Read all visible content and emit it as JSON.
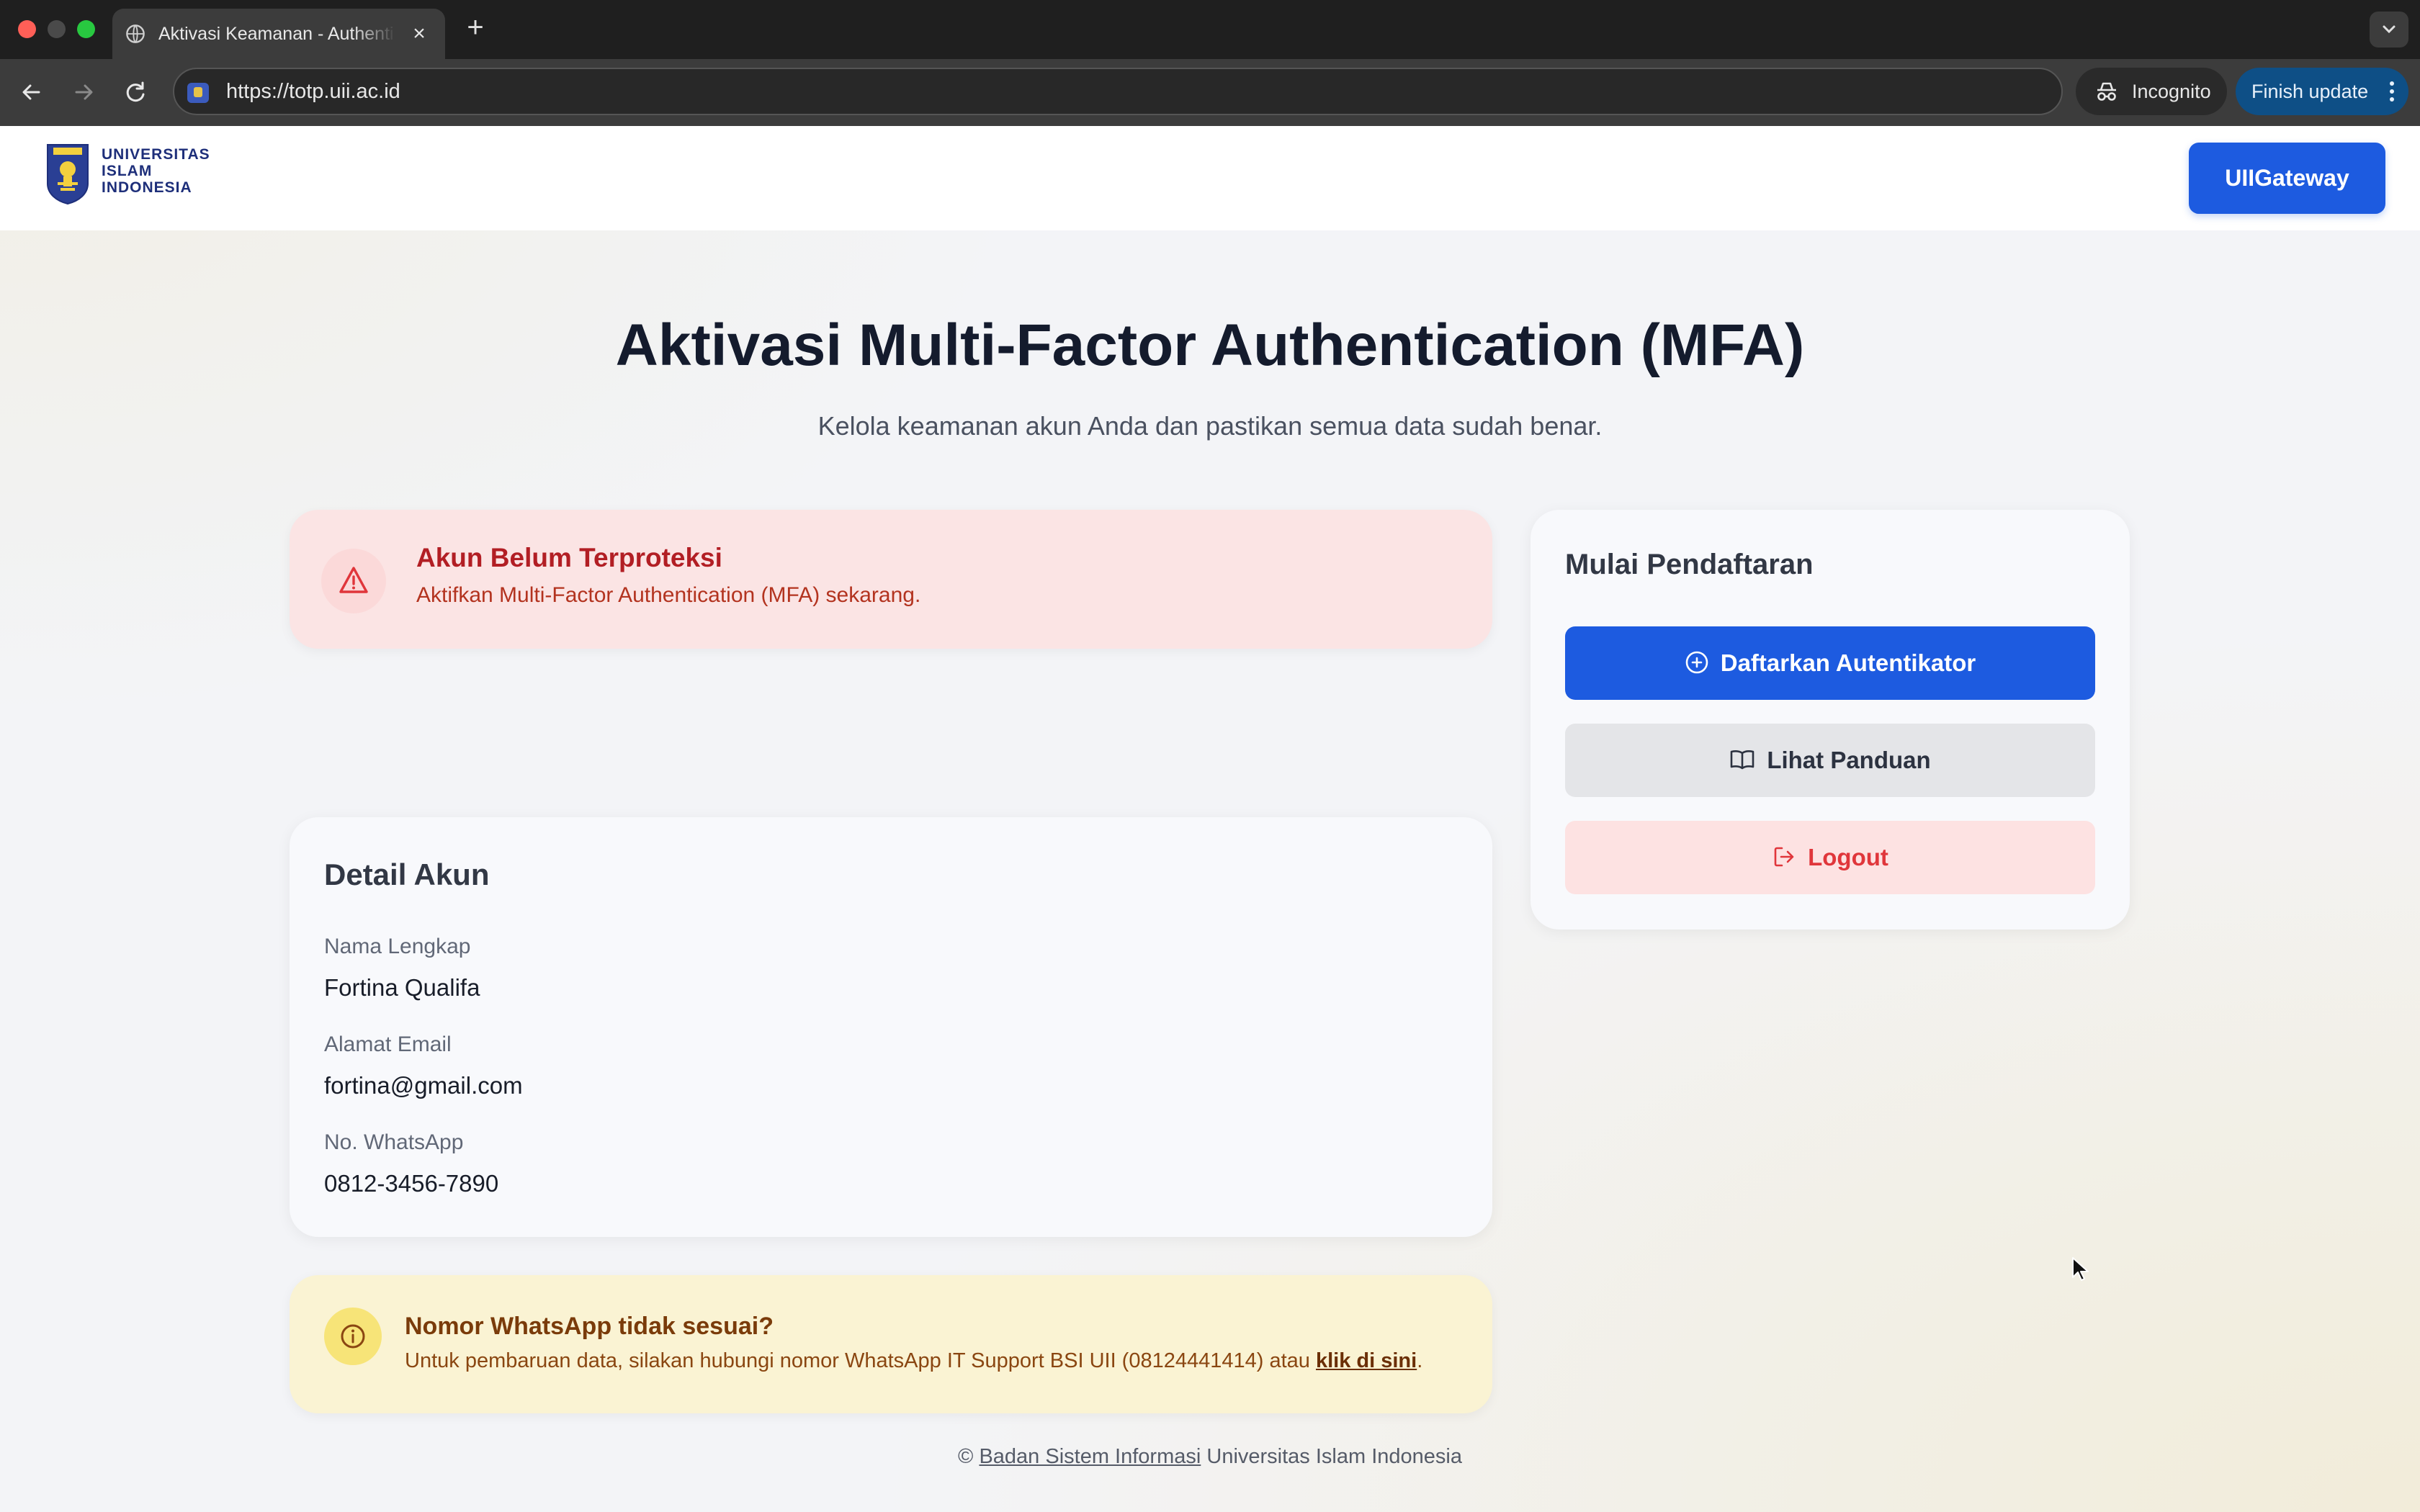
{
  "browser": {
    "tab_title": "Aktivasi Keamanan - Authenti",
    "url": "https://totp.uii.ac.id",
    "incognito_label": "Incognito",
    "finish_update_label": "Finish update"
  },
  "header": {
    "logo_lines": [
      "UNIVERSITAS",
      "ISLAM",
      "INDONESIA"
    ],
    "gateway_button": "UIIGateway"
  },
  "main": {
    "title": "Aktivasi Multi-Factor Authentication (MFA)",
    "subtitle": "Kelola keamanan akun Anda dan pastikan semua data sudah benar."
  },
  "alert": {
    "title": "Akun Belum Terproteksi",
    "message": "Aktifkan Multi-Factor Authentication (MFA) sekarang."
  },
  "account": {
    "heading": "Detail Akun",
    "name_label": "Nama Lengkap",
    "name_value": "Fortina Qualifa",
    "email_label": "Alamat Email",
    "email_value": "fortina@gmail.com",
    "whatsapp_label": "No. WhatsApp",
    "whatsapp_value": "0812-3456-7890"
  },
  "notice": {
    "title": "Nomor WhatsApp tidak sesuai?",
    "text_before": "Untuk pembaruan data, silakan hubungi nomor WhatsApp IT Support BSI UII (08124441414) atau ",
    "link": "klik di sini",
    "text_after": "."
  },
  "registration": {
    "heading": "Mulai Pendaftaran",
    "register_button": "Daftarkan Autentikator",
    "guide_button": "Lihat Panduan",
    "logout_button": "Logout"
  },
  "footer": {
    "copyright": "©",
    "link": "Badan Sistem Informasi",
    "org": "Universitas Islam Indonesia"
  },
  "colors": {
    "primary": "#1d5be0",
    "danger": "#e0363b",
    "warning_bg": "#faf3d3",
    "alert_bg": "#fbe4e4"
  }
}
